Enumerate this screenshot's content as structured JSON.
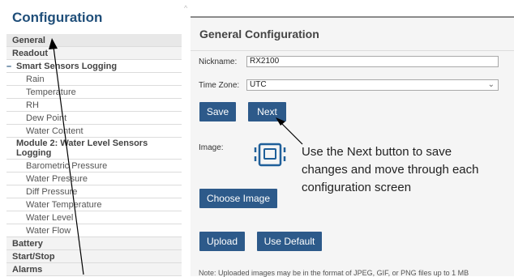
{
  "sidebar": {
    "title": "Configuration",
    "items": [
      {
        "label": "General",
        "kind": "top",
        "active": true
      },
      {
        "label": "Readout",
        "kind": "top"
      },
      {
        "label": "Smart Sensors Logging",
        "kind": "group"
      },
      {
        "label": "Rain",
        "kind": "child"
      },
      {
        "label": "Temperature",
        "kind": "child"
      },
      {
        "label": "RH",
        "kind": "child"
      },
      {
        "label": "Dew Point",
        "kind": "child"
      },
      {
        "label": "Water Content",
        "kind": "child"
      },
      {
        "label": "Module 2: Water Level Sensors Logging",
        "kind": "group2"
      },
      {
        "label": "Barometric Pressure",
        "kind": "child"
      },
      {
        "label": "Water Pressure",
        "kind": "child"
      },
      {
        "label": "Diff Pressure",
        "kind": "child"
      },
      {
        "label": "Water Temperature",
        "kind": "child"
      },
      {
        "label": "Water Level",
        "kind": "child"
      },
      {
        "label": "Water Flow",
        "kind": "child"
      },
      {
        "label": "Battery",
        "kind": "top"
      },
      {
        "label": "Start/Stop",
        "kind": "top"
      },
      {
        "label": "Alarms",
        "kind": "top"
      }
    ]
  },
  "main": {
    "title": "General Configuration",
    "nickname_label": "Nickname:",
    "nickname_value": "RX2100",
    "timezone_label": "Time Zone:",
    "timezone_value": "UTC",
    "save_label": "Save",
    "next_label": "Next",
    "image_label": "Image:",
    "choose_image_label": "Choose Image",
    "upload_label": "Upload",
    "use_default_label": "Use Default",
    "note": "Note: Uploaded images may be in the format of JPEG, GIF, or PNG files up to 1 MB"
  },
  "annotation": {
    "lines": [
      "Use the Next button to save",
      "changes and move through each",
      "configuration screen"
    ]
  },
  "colors": {
    "accent": "#2d5a8a",
    "title": "#1f4e79"
  },
  "icons": {
    "image_placeholder": "device-frame-icon",
    "dash": "collapse-dash-icon",
    "chevron": "chevron-down-icon"
  }
}
